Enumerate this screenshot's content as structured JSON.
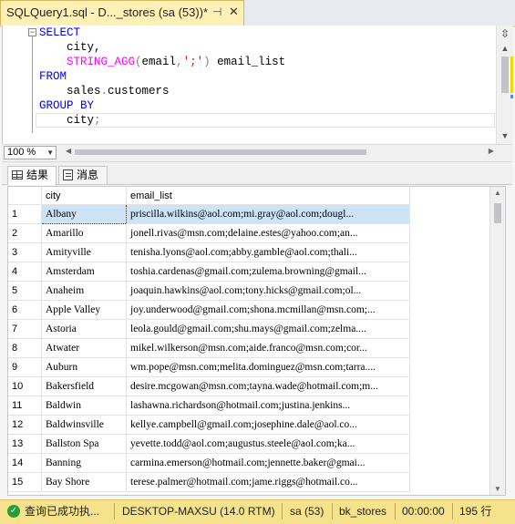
{
  "tab": {
    "title": "SQLQuery1.sql - D..._stores (sa (53))*",
    "pin_glyph": "⊣",
    "close_glyph": "✕"
  },
  "editor": {
    "lines": [
      [
        {
          "t": "SELECT",
          "c": "kw"
        }
      ],
      [
        {
          "t": "    city,",
          "c": "tx"
        }
      ],
      [
        {
          "t": "    STRING_AGG",
          "c": "fn"
        },
        {
          "t": "(",
          "c": "gr"
        },
        {
          "t": "email",
          "c": "tx"
        },
        {
          "t": ",",
          "c": "gr"
        },
        {
          "t": "';'",
          "c": "str"
        },
        {
          "t": ")",
          "c": "gr"
        },
        {
          "t": " email_list",
          "c": "tx"
        }
      ],
      [
        {
          "t": "FROM",
          "c": "kw"
        }
      ],
      [
        {
          "t": "    sales",
          "c": "tx"
        },
        {
          "t": ".",
          "c": "gr"
        },
        {
          "t": "customers",
          "c": "tx"
        }
      ],
      [
        {
          "t": "GROUP BY",
          "c": "kw"
        }
      ],
      [
        {
          "t": "    city",
          "c": "tx"
        },
        {
          "t": ";",
          "c": "gr"
        }
      ]
    ],
    "collapse_glyph": "−"
  },
  "zoom": {
    "value": "100 %"
  },
  "results_tabs": [
    {
      "label": "结果",
      "icon": "grid-icon"
    },
    {
      "label": "消息",
      "icon": "message-icon"
    }
  ],
  "grid": {
    "columns": [
      "city",
      "email_list"
    ],
    "rows": [
      [
        "1",
        "Albany",
        "priscilla.wilkins@aol.com;mi.gray@aol.com;dougl..."
      ],
      [
        "2",
        "Amarillo",
        "jonell.rivas@msn.com;delaine.estes@yahoo.com;an..."
      ],
      [
        "3",
        "Amityville",
        "tenisha.lyons@aol.com;abby.gamble@aol.com;thali..."
      ],
      [
        "4",
        "Amsterdam",
        "toshia.cardenas@gmail.com;zulema.browning@gmail..."
      ],
      [
        "5",
        "Anaheim",
        "joaquin.hawkins@aol.com;tony.hicks@gmail.com;ol..."
      ],
      [
        "6",
        "Apple Valley",
        "joy.underwood@gmail.com;shona.mcmillan@msn.com;..."
      ],
      [
        "7",
        "Astoria",
        "leola.gould@gmail.com;shu.mays@gmail.com;zelma...."
      ],
      [
        "8",
        "Atwater",
        "mikel.wilkerson@msn.com;aide.franco@msn.com;cor..."
      ],
      [
        "9",
        "Auburn",
        "wm.pope@msn.com;melita.dominguez@msn.com;tarra...."
      ],
      [
        "10",
        "Bakersfield",
        "desire.mcgowan@msn.com;tayna.wade@hotmail.com;m..."
      ],
      [
        "11",
        "Baldwin",
        "lashawna.richardson@hotmail.com;justina.jenkins..."
      ],
      [
        "12",
        "Baldwinsville",
        "kellye.campbell@gmail.com;josephine.dale@aol.co..."
      ],
      [
        "13",
        "Ballston Spa",
        "yevette.todd@aol.com;augustus.steele@aol.com;ka..."
      ],
      [
        "14",
        "Banning",
        "carmina.emerson@hotmail.com;jennette.baker@gmai..."
      ],
      [
        "15",
        "Bay Shore",
        "terese.palmer@hotmail.com;jame.riggs@hotmail.co..."
      ]
    ],
    "selected_row": 0
  },
  "status": {
    "message": "查询已成功执...",
    "server": "DESKTOP-MAXSU (14.0 RTM)",
    "user": "sa (53)",
    "database": "bk_stores",
    "time": "00:00:00",
    "rows": "195 行",
    "color": "#f5e28b"
  }
}
